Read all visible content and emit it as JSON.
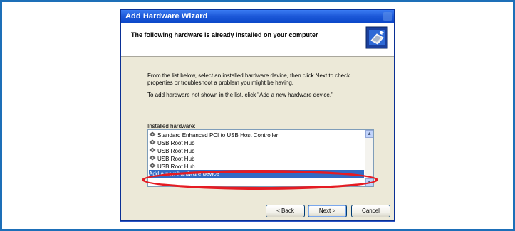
{
  "window": {
    "title": "Add Hardware Wizard"
  },
  "header": {
    "heading": "The following hardware is already installed on your computer",
    "icon": "hardware-wizard-icon"
  },
  "body": {
    "instruction": "From the list below, select an installed hardware device, then click Next to check properties or troubleshoot a problem you might be having.",
    "add_hint": "To add hardware not shown in the list, click \"Add a new hardware device.\"",
    "list_label": "Installed hardware:"
  },
  "list": {
    "items": [
      {
        "label": "Standard Enhanced PCI to USB Host Controller",
        "icon": "usb-controller-icon"
      },
      {
        "label": "USB Root Hub",
        "icon": "usb-hub-icon"
      },
      {
        "label": "USB Root Hub",
        "icon": "usb-hub-icon"
      },
      {
        "label": "USB Root Hub",
        "icon": "usb-hub-icon"
      },
      {
        "label": "USB Root Hub",
        "icon": "usb-hub-icon"
      }
    ],
    "selected_item": "Add a new hardware device"
  },
  "buttons": {
    "back": "< Back",
    "next": "Next >",
    "cancel": "Cancel"
  },
  "colors": {
    "frame": "#1d6fb8",
    "titlebar": "#0a46c8",
    "selection": "#316ac5",
    "annotation": "#e51b23"
  }
}
